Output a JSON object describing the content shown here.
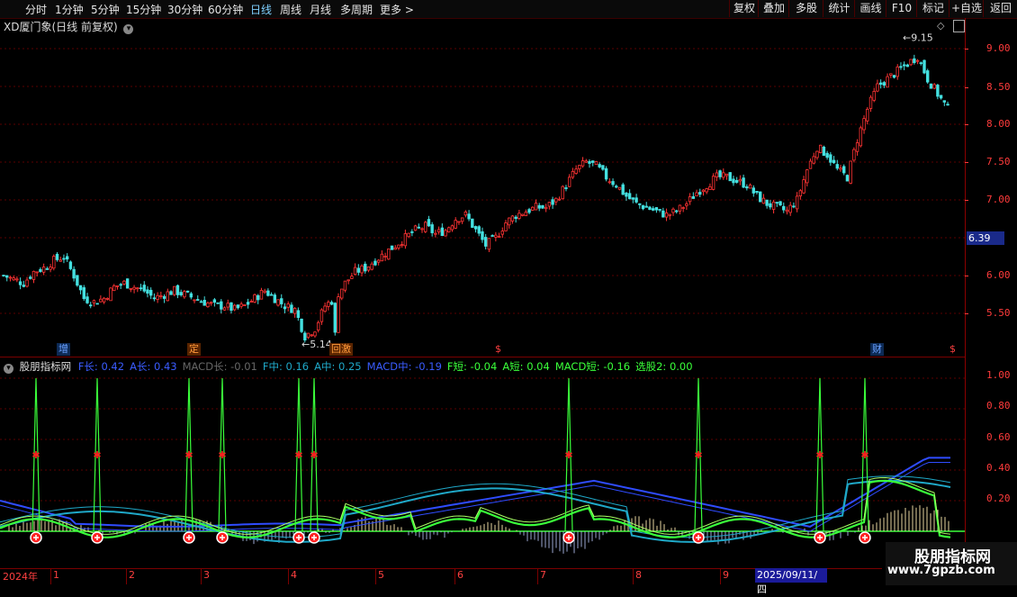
{
  "toolbar": {
    "periods": [
      {
        "label": "分时",
        "active": false
      },
      {
        "label": "1分钟",
        "active": false
      },
      {
        "label": "5分钟",
        "active": false
      },
      {
        "label": "15分钟",
        "active": false
      },
      {
        "label": "30分钟",
        "active": false
      },
      {
        "label": "60分钟",
        "active": false
      },
      {
        "label": "日线",
        "active": true
      },
      {
        "label": "周线",
        "active": false
      },
      {
        "label": "月线",
        "active": false
      },
      {
        "label": "多周期",
        "active": false
      },
      {
        "label": "更多 >",
        "active": false
      }
    ],
    "right_buttons": [
      "复权",
      "叠加",
      "多股",
      "统计",
      "画线",
      "F10",
      "标记",
      "+自选",
      "返回"
    ]
  },
  "main_chart": {
    "title": "XD厦门象(日线 前复权)",
    "high_label": "9.15",
    "low_label": "5.14",
    "current_price": "6.39",
    "price_ticks": [
      "9.00",
      "8.50",
      "8.00",
      "7.50",
      "7.00",
      "6.00",
      "5.50"
    ],
    "event_flags": [
      {
        "label": "增",
        "color": "#6aa0ff"
      },
      {
        "label": "定",
        "color": "#ff9a3a"
      },
      {
        "label": "回激",
        "color": "#ff9a3a"
      },
      {
        "label": "$",
        "color": "#ff4040"
      },
      {
        "label": "财",
        "color": "#6aa0ff"
      },
      {
        "label": "$",
        "color": "#ff4040"
      }
    ]
  },
  "indicator": {
    "name": "股朋指标网",
    "values": [
      {
        "text": "F长: 0.42",
        "color": "#3a5cff"
      },
      {
        "text": "A长: 0.43",
        "color": "#3a5cff"
      },
      {
        "text": "MACD长: -0.01",
        "color": "#666666"
      },
      {
        "text": "F中: 0.16",
        "color": "#1fa8c8"
      },
      {
        "text": "A中: 0.25",
        "color": "#1fa8c8"
      },
      {
        "text": "MACD中: -0.19",
        "color": "#3a5cff"
      },
      {
        "text": "F短: -0.04",
        "color": "#3aff3a"
      },
      {
        "text": "A短: 0.04",
        "color": "#3aff3a"
      },
      {
        "text": "MACD短: -0.16",
        "color": "#3aff3a"
      },
      {
        "text": "选股2: 0.00",
        "color": "#3aff3a"
      }
    ],
    "ticks": [
      "1.00",
      "0.80",
      "0.60",
      "0.40",
      "0.20"
    ]
  },
  "date_axis": {
    "year": "2024年",
    "months": [
      "1",
      "2",
      "3",
      "4",
      "5",
      "6",
      "7",
      "8",
      "9"
    ],
    "cursor": "2025/09/11/四"
  },
  "watermark": {
    "title": "股朋指标网",
    "url": "www.7gpzb.com"
  },
  "chart_data": {
    "type": "candlestick",
    "title": "XD厦门象(日线 前复权)",
    "ylim": [
      5.0,
      9.3
    ],
    "close_series": [
      6.0,
      5.95,
      5.9,
      6.05,
      6.1,
      6.2,
      6.25,
      6.0,
      5.7,
      5.65,
      5.7,
      5.85,
      5.9,
      5.85,
      5.8,
      5.7,
      5.75,
      5.8,
      5.75,
      5.7,
      5.65,
      5.6,
      5.6,
      5.55,
      5.6,
      5.7,
      5.8,
      5.7,
      5.6,
      5.55,
      5.2,
      5.3,
      5.6,
      5.7,
      5.9,
      6.05,
      6.1,
      6.2,
      6.3,
      6.4,
      6.5,
      6.6,
      6.65,
      6.55,
      6.6,
      6.75,
      6.8,
      6.6,
      6.4,
      6.5,
      6.7,
      6.8,
      6.85,
      6.9,
      6.9,
      7.0,
      7.2,
      7.4,
      7.5,
      7.45,
      7.3,
      7.2,
      7.05,
      6.95,
      6.9,
      6.85,
      6.8,
      6.85,
      6.95,
      7.1,
      7.2,
      7.3,
      7.3,
      7.25,
      7.2,
      7.05,
      6.95,
      6.9,
      6.85,
      7.0,
      7.4,
      7.7,
      7.6,
      7.4,
      7.3,
      7.8,
      8.2,
      8.5,
      8.6,
      8.7,
      8.8,
      8.9,
      8.6,
      8.4,
      8.2
    ],
    "high": 9.15,
    "low": 5.14,
    "current": 6.39
  }
}
